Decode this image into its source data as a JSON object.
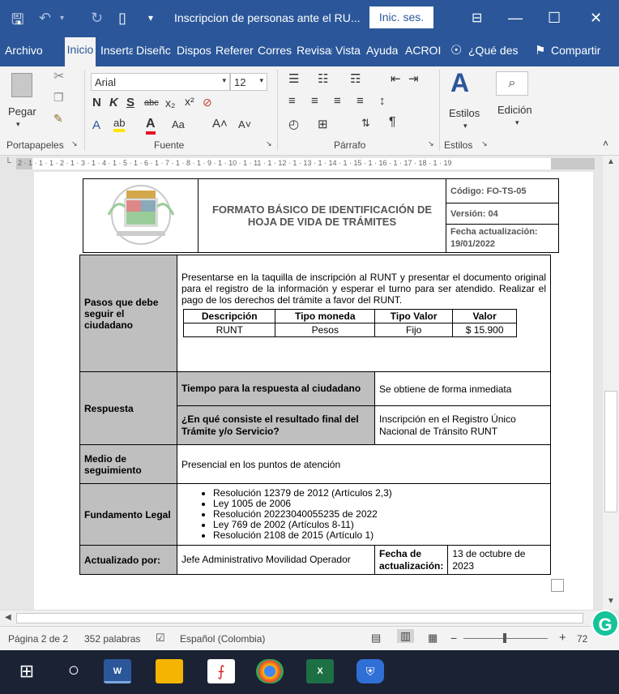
{
  "window": {
    "title": "Inscripcion de personas ante el RU...",
    "signin": "Inic. ses."
  },
  "menu": {
    "items": [
      "Archivo",
      "Inicio",
      "Inserta",
      "Diseñc",
      "Dispos",
      "Referer",
      "Corres",
      "Revisar",
      "Vista",
      "Ayuda",
      "ACROI"
    ],
    "tell_me": "¿Qué des",
    "share": "Compartir"
  },
  "ribbon": {
    "font_name": "Arial",
    "font_size": "12",
    "paste": "Pegar",
    "styles": "Estilos",
    "editing": "Edición",
    "groups": {
      "clipboard": "Portapapeles",
      "font": "Fuente",
      "paragraph": "Párrafo",
      "styles": "Estilos"
    }
  },
  "ruler": {
    "ticks": "2 · 1 · 1 · 1 · 2 · 1 · 3 · 1 · 4 · 1 · 5 · 1 · 6 · 1 · 7 · 1 · 8 · 1 · 9 · 1 · 10 · 1 · 11 · 1 · 12 · 1 · 13 · 1 · 14 · 1 · 15 · 1 · 16 · 1 · 17 · 18 · 1 · 19"
  },
  "header": {
    "title_line1": "FORMATO BÁSICO DE IDENTIFICACIÓN DE",
    "title_line2": "HOJA DE VIDA DE TRÁMITES",
    "code": "Código: FO-TS-05",
    "version": "Versión: 04",
    "date_label": "Fecha actualización:",
    "date": "19/01/2022"
  },
  "steps": {
    "label": "Pasos que debe seguir el ciudadano",
    "text": "Presentarse en la taquilla de inscripción al RUNT y presentar el documento original para el registro de la información y esperar el turno para ser atendido. Realizar el pago de los derechos del trámite a favor del RUNT.",
    "fee_headers": [
      "Descripción",
      "Tipo moneda",
      "Tipo Valor",
      "Valor"
    ],
    "fee_row": [
      "RUNT",
      "Pesos",
      "Fijo",
      "$ 15.900"
    ]
  },
  "response": {
    "label": "Respuesta",
    "time_label": "Tiempo para la respuesta al ciudadano",
    "time_value": "Se obtiene de forma inmediata",
    "result_label": "¿En qué consiste el resultado final del Trámite y/o Servicio?",
    "result_value": "Inscripción en el Registro Único Nacional de Tránsito RUNT"
  },
  "followup": {
    "label": "Medio de seguimiento",
    "value": "Presencial en los puntos de atención"
  },
  "legal": {
    "label": "Fundamento Legal",
    "items": [
      "Resolución 12379 de 2012 (Artículos 2,3)",
      "Ley 1005 de 2006",
      "Resolución 20223040055235 de 2022",
      "Ley 769 de 2002 (Artículos 8-11)",
      "Resolución 2108 de 2015 (Artículo 1)"
    ]
  },
  "updated": {
    "label": "Actualizado por:",
    "value": "Jefe Administrativo Movilidad Operador",
    "date_label": "Fecha de actualización:",
    "date_value": "13 de octubre de 2023"
  },
  "status": {
    "page": "Página 2 de 2",
    "words": "352 palabras",
    "language": "Español (Colombia)",
    "zoom": "72"
  },
  "colors": {
    "brand": "#2b579a",
    "taskbar": "#1a2234",
    "cell_gray": "#bfbfbf"
  }
}
